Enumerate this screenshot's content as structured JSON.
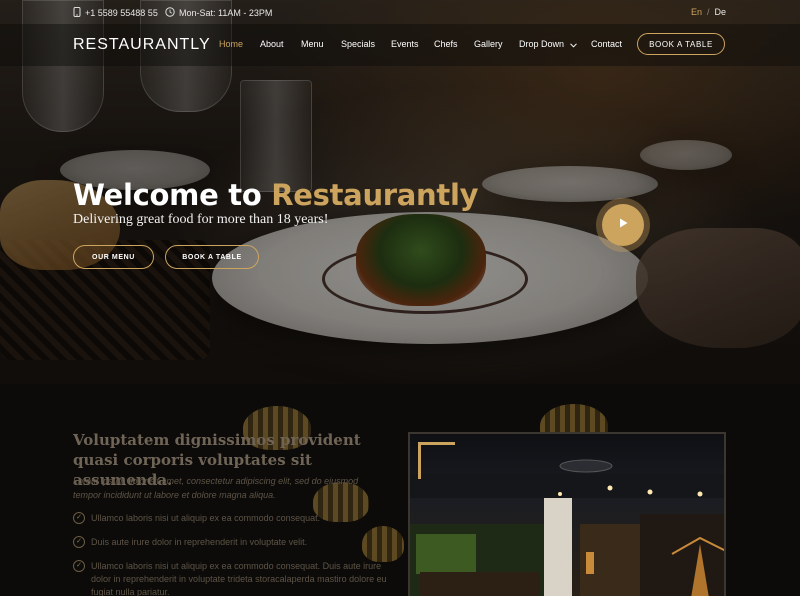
{
  "topbar": {
    "phone": "+1 5589 55488 55",
    "hours": "Mon-Sat: 11AM - 23PM",
    "lang_en": "En",
    "lang_sep": "/",
    "lang_de": "De"
  },
  "nav": {
    "logo": "RESTAURANTLY",
    "items": [
      "Home",
      "About",
      "Menu",
      "Specials",
      "Events",
      "Chefs",
      "Gallery",
      "Drop Down",
      "Contact"
    ],
    "book_label": "BOOK A TABLE"
  },
  "hero": {
    "title_prefix": "Welcome to ",
    "title_brand": "Restaurantly",
    "subtitle": "Delivering great food for more than 18 years!",
    "btn_menu": "OUR MENU",
    "btn_book": "BOOK A TABLE"
  },
  "about": {
    "heading": "Voluptatem dignissimos provident quasi corporis voluptates sit assumenda.",
    "lead": "Lorem ipsum dolor sit amet, consectetur adipiscing elit, sed do eiusmod tempor incididunt ut labore et dolore magna aliqua.",
    "points": [
      "Ullamco laboris nisi ut aliquip ex ea commodo consequat.",
      "Duis aute irure dolor in reprehenderit in voluptate velit.",
      "Ullamco laboris nisi ut aliquip ex ea commodo consequat. Duis aute irure dolor in reprehenderit in voluptate trideta storacalaperda mastiro dolore eu fugiat nulla pariatur."
    ]
  },
  "colors": {
    "accent": "#cda45e",
    "background": "#0c0b09"
  },
  "icons": {
    "phone": "phone-icon",
    "clock": "clock-icon",
    "play": "play-icon",
    "check": "check-circle-icon",
    "dropdown": "chevron-down-icon"
  }
}
